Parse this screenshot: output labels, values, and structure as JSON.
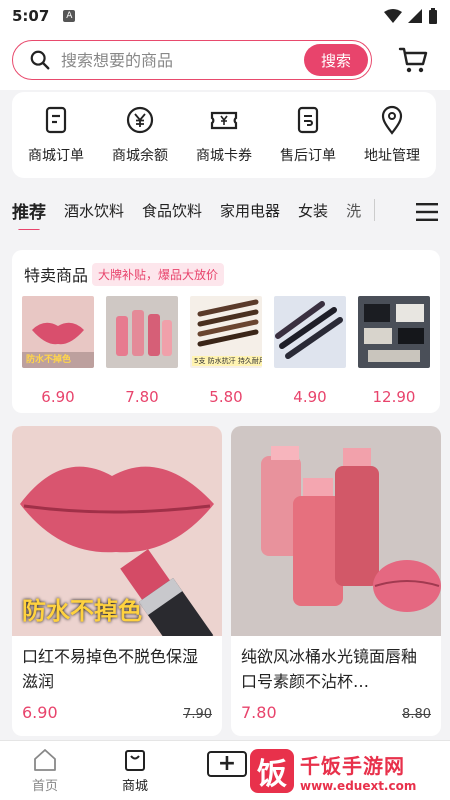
{
  "status_bar": {
    "time": "5:07",
    "badge": "A"
  },
  "search": {
    "placeholder": "搜索想要的商品",
    "button_label": "搜索"
  },
  "quick_menu": [
    {
      "label": "商城订单",
      "icon": "order-list-icon"
    },
    {
      "label": "商城余额",
      "icon": "yuan-coin-icon"
    },
    {
      "label": "商城卡券",
      "icon": "coupon-icon"
    },
    {
      "label": "售后订单",
      "icon": "after-sale-icon"
    },
    {
      "label": "地址管理",
      "icon": "location-pin-icon"
    }
  ],
  "tabs": [
    {
      "label": "推荐",
      "active": true
    },
    {
      "label": "酒水饮料"
    },
    {
      "label": "食品饮料"
    },
    {
      "label": "家用电器"
    },
    {
      "label": "女装"
    },
    {
      "label": "洗"
    }
  ],
  "special": {
    "title": "特卖商品",
    "badge": "大牌补贴，爆品大放价",
    "items": [
      {
        "price": "6.90",
        "image": "lips-lipstick",
        "caption": "防水不掉色"
      },
      {
        "price": "7.80",
        "image": "lip-gloss-set"
      },
      {
        "price": "5.80",
        "image": "eyebrow-pencils",
        "caption": "5支 防水抗汗 持久耐用"
      },
      {
        "price": "4.90",
        "image": "eyeliner-pens"
      },
      {
        "price": "12.90",
        "image": "eyeshadow-palettes"
      }
    ]
  },
  "products": [
    {
      "title": "口红不易掉色不脱色保湿滋润",
      "price": "6.90",
      "old_price": "7.90",
      "image_caption": "防水不掉色"
    },
    {
      "title": "纯欲风冰桶水光镜面唇釉口号素颜不沾杯…",
      "price": "7.80",
      "old_price": "8.80"
    }
  ],
  "bottom_nav": [
    {
      "label": "首页",
      "icon": "home-icon"
    },
    {
      "label": "商城",
      "icon": "shop-bag-icon",
      "active": true
    },
    {
      "label": "",
      "icon": "plus-icon"
    }
  ],
  "watermark": {
    "logo_char": "饭",
    "title": "千饭手游网",
    "url": "www.eduext.com"
  },
  "colors": {
    "accent": "#e8446c",
    "watermark": "#e8314b"
  }
}
